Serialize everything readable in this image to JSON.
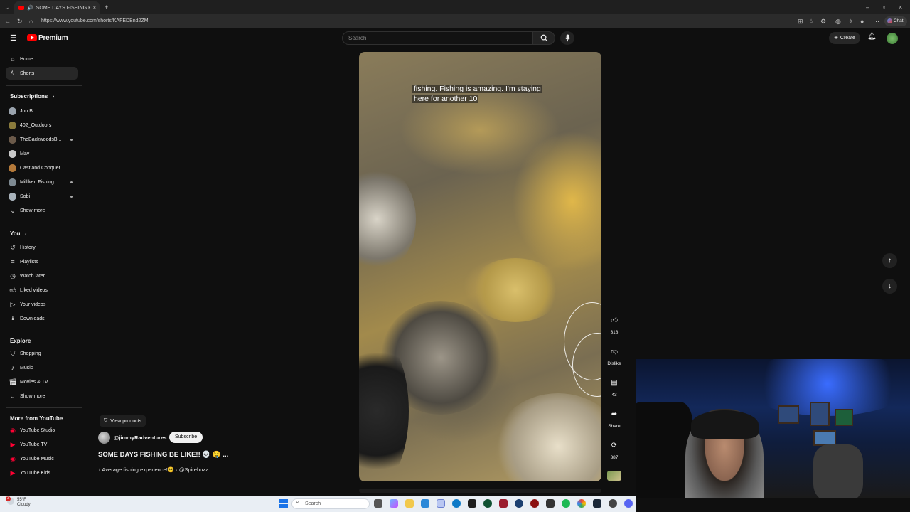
{
  "browser": {
    "tab_title": "SOME DAYS FISHING BE LIKE",
    "tab_close": "×",
    "new_tab": "+",
    "url": "https://www.youtube.com/shorts/KAFEDBnd2ZM",
    "chat_label": "Chat"
  },
  "header": {
    "brand": "Premium",
    "search_placeholder": "Search",
    "create_label": "Create"
  },
  "sidebar": {
    "main": [
      {
        "label": "Home",
        "icon": "home-icon"
      },
      {
        "label": "Shorts",
        "icon": "shorts-icon",
        "active": true
      }
    ],
    "subscriptions_title": "Subscriptions",
    "subscriptions": [
      {
        "label": "Jon B.",
        "color": "#9aa3ad"
      },
      {
        "label": "402_Outdoors",
        "color": "#8a7b3c"
      },
      {
        "label": "TheBackwoodsB...",
        "color": "#6b5a4a",
        "dot": true
      },
      {
        "label": "Mav",
        "color": "#c9c9c9"
      },
      {
        "label": "Cast and Conquer",
        "color": "#b57a3a"
      },
      {
        "label": "Milliken Fishing",
        "color": "#7e8a92",
        "dot": true
      },
      {
        "label": "Sobi",
        "color": "#a9b3bb",
        "dot": true
      }
    ],
    "subscriptions_more": "Show more",
    "you_title": "You",
    "you": [
      {
        "label": "History",
        "icon": "history-icon"
      },
      {
        "label": "Playlists",
        "icon": "playlists-icon"
      },
      {
        "label": "Watch later",
        "icon": "clock-icon"
      },
      {
        "label": "Liked videos",
        "icon": "thumbs-up-icon"
      },
      {
        "label": "Your videos",
        "icon": "play-square-icon"
      },
      {
        "label": "Downloads",
        "icon": "download-icon"
      }
    ],
    "explore_title": "Explore",
    "explore": [
      {
        "label": "Shopping",
        "icon": "shopping-bag-icon"
      },
      {
        "label": "Music",
        "icon": "music-note-icon"
      },
      {
        "label": "Movies & TV",
        "icon": "clapperboard-icon"
      }
    ],
    "explore_more": "Show more",
    "more_title": "More from YouTube",
    "more": [
      {
        "label": "YouTube Studio"
      },
      {
        "label": "YouTube TV"
      },
      {
        "label": "YouTube Music"
      },
      {
        "label": "YouTube Kids"
      }
    ]
  },
  "video": {
    "caption_line1": "fishing. Fishing is amazing. I'm staying",
    "caption_line2": "here for another 10",
    "view_products": "View products",
    "channel": "@jimmyRadventures",
    "subscribe": "Subscribe",
    "title": "SOME DAYS FISHING BE LIKE!! 💀 🤤 ...",
    "description": "♪ Average fishing experience!😣 · @Spirebuzz"
  },
  "actions": {
    "likes": "318",
    "dislike": "Dislike",
    "comments": "43",
    "share": "Share",
    "remix": "387"
  },
  "taskbar": {
    "search_placeholder": "Search",
    "weather_temp": "55°F",
    "weather_desc": "Cloudy",
    "notification_count": "3"
  }
}
